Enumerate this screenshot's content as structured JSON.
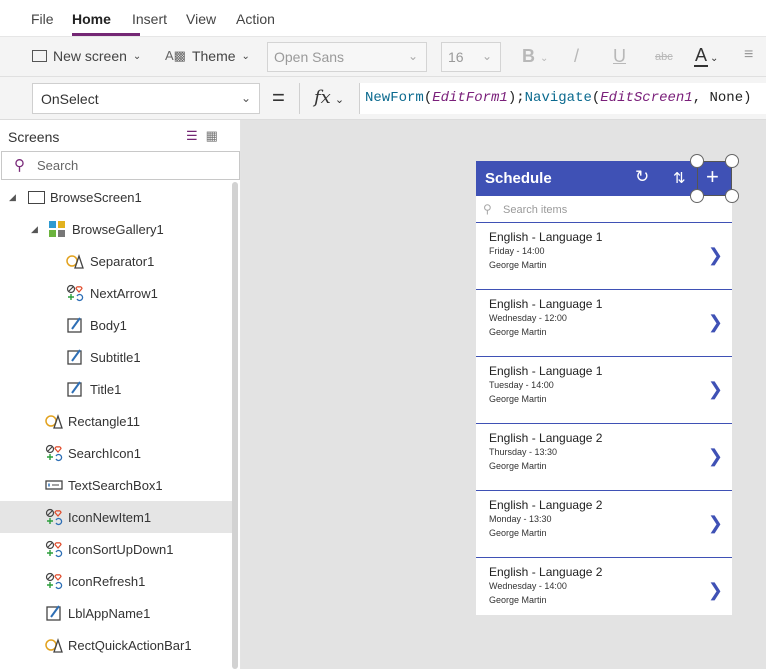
{
  "menu": {
    "items": [
      "File",
      "Home",
      "Insert",
      "View",
      "Action"
    ],
    "active": "Home"
  },
  "toolbar": {
    "new_screen": "New screen",
    "theme": "Theme",
    "font": "Open Sans",
    "font_size": "16",
    "bold": "B",
    "italic": "/",
    "underline": "U",
    "strike": "abc",
    "font_color": "A"
  },
  "formula": {
    "property": "OnSelect",
    "equals": "=",
    "fx": "fx",
    "parts": [
      "NewForm",
      "(",
      "EditForm1",
      ");",
      "Navigate",
      "(",
      "EditScreen1",
      ", None)"
    ]
  },
  "left_panel": {
    "title": "Screens",
    "search_placeholder": "Search",
    "tree": [
      {
        "label": "BrowseScreen1",
        "icon": "screen-icon"
      },
      {
        "label": "BrowseGallery1",
        "icon": "gallery-icon"
      },
      {
        "label": "Separator1",
        "icon": "shape-icon"
      },
      {
        "label": "NextArrow1",
        "icon": "icon-control-icon"
      },
      {
        "label": "Body1",
        "icon": "label-icon"
      },
      {
        "label": "Subtitle1",
        "icon": "label-icon"
      },
      {
        "label": "Title1",
        "icon": "label-icon"
      },
      {
        "label": "Rectangle11",
        "icon": "shape-icon"
      },
      {
        "label": "SearchIcon1",
        "icon": "icon-control-icon"
      },
      {
        "label": "TextSearchBox1",
        "icon": "textbox-icon"
      },
      {
        "label": "IconNewItem1",
        "icon": "icon-control-icon"
      },
      {
        "label": "IconSortUpDown1",
        "icon": "icon-control-icon"
      },
      {
        "label": "IconRefresh1",
        "icon": "icon-control-icon"
      },
      {
        "label": "LblAppName1",
        "icon": "label-icon"
      },
      {
        "label": "RectQuickActionBar1",
        "icon": "shape-icon"
      }
    ],
    "selected": "IconNewItem1"
  },
  "app": {
    "title": "Schedule",
    "search_placeholder": "Search items",
    "items": [
      {
        "title": "English - Language 1",
        "subtitle": "Friday - 14:00",
        "body": "George Martin"
      },
      {
        "title": "English - Language 1",
        "subtitle": "Wednesday - 12:00",
        "body": "George Martin"
      },
      {
        "title": "English - Language 1",
        "subtitle": "Tuesday - 14:00",
        "body": "George Martin"
      },
      {
        "title": "English - Language 2",
        "subtitle": "Thursday - 13:30",
        "body": "George Martin"
      },
      {
        "title": "English - Language 2",
        "subtitle": "Monday - 13:30",
        "body": "George Martin"
      },
      {
        "title": "English - Language 2",
        "subtitle": "Wednesday - 14:00",
        "body": "George Martin"
      }
    ]
  },
  "colors": {
    "accent": "#742774",
    "app_header": "#3f51b5",
    "selection_bg": "#e5e5e5",
    "canvas": "#e3e3e3"
  }
}
